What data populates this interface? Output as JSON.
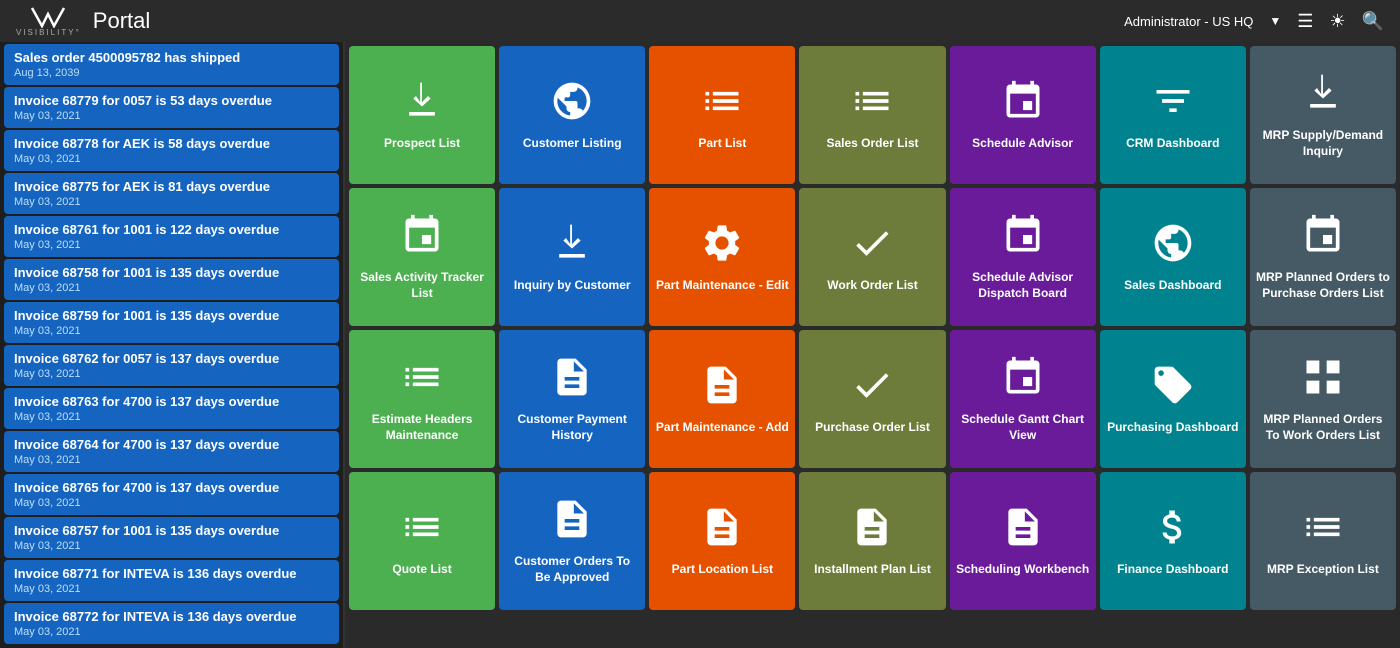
{
  "header": {
    "logo_v": "V",
    "logo_brand": "VISIBILITY°",
    "portal_label": "Portal",
    "admin_label": "Administrator - US HQ",
    "icons": [
      "hamburger",
      "globe",
      "search"
    ]
  },
  "sidebar": {
    "items": [
      {
        "title": "Sales order 4500095782 has shipped",
        "date": "Aug 13, 2039"
      },
      {
        "title": "Invoice 68779 for 0057 is 53 days overdue",
        "date": "May 03, 2021"
      },
      {
        "title": "Invoice 68778 for AEK is 58 days overdue",
        "date": "May 03, 2021"
      },
      {
        "title": "Invoice 68775 for AEK is 81 days overdue",
        "date": "May 03, 2021"
      },
      {
        "title": "Invoice 68761 for 1001 is 122 days overdue",
        "date": "May 03, 2021"
      },
      {
        "title": "Invoice 68758 for 1001 is 135 days overdue",
        "date": "May 03, 2021"
      },
      {
        "title": "Invoice 68759 for 1001 is 135 days overdue",
        "date": "May 03, 2021"
      },
      {
        "title": "Invoice 68762 for 0057 is 137 days overdue",
        "date": "May 03, 2021"
      },
      {
        "title": "Invoice 68763 for 4700 is 137 days overdue",
        "date": "May 03, 2021"
      },
      {
        "title": "Invoice 68764 for 4700 is 137 days overdue",
        "date": "May 03, 2021"
      },
      {
        "title": "Invoice 68765 for 4700 is 137 days overdue",
        "date": "May 03, 2021"
      },
      {
        "title": "Invoice 68757 for 1001 is 135 days overdue",
        "date": "May 03, 2021"
      },
      {
        "title": "Invoice 68771 for INTEVA is 136 days overdue",
        "date": "May 03, 2021"
      },
      {
        "title": "Invoice 68772 for INTEVA is 136 days overdue",
        "date": "May 03, 2021"
      }
    ]
  },
  "grid": {
    "rows": [
      [
        {
          "label": "Prospect List",
          "color": "green",
          "icon": "download-box"
        },
        {
          "label": "Customer Listing",
          "color": "blue",
          "icon": "globe"
        },
        {
          "label": "Part List",
          "color": "orange",
          "icon": "list"
        },
        {
          "label": "Sales Order List",
          "color": "olive",
          "icon": "list"
        },
        {
          "label": "Schedule Advisor",
          "color": "purple",
          "icon": "calendar"
        },
        {
          "label": "CRM Dashboard",
          "color": "teal",
          "icon": "funnel"
        },
        {
          "label": "MRP Supply/Demand Inquiry",
          "color": "dark-gray",
          "icon": "download-box"
        }
      ],
      [
        {
          "label": "Sales Activity Tracker List",
          "color": "green",
          "icon": "calendar"
        },
        {
          "label": "Inquiry by Customer",
          "color": "blue",
          "icon": "download-box"
        },
        {
          "label": "Part Maintenance - Edit",
          "color": "orange",
          "icon": "gear"
        },
        {
          "label": "Work Order List",
          "color": "olive",
          "icon": "checkmark"
        },
        {
          "label": "Schedule Advisor Dispatch Board",
          "color": "purple",
          "icon": "calendar"
        },
        {
          "label": "Sales Dashboard",
          "color": "teal",
          "icon": "globe"
        },
        {
          "label": "MRP Planned Orders to Purchase Orders List",
          "color": "dark-gray",
          "icon": "calendar-check"
        }
      ],
      [
        {
          "label": "Estimate Headers Maintenance",
          "color": "green",
          "icon": "list-lines"
        },
        {
          "label": "Customer Payment History",
          "color": "blue",
          "icon": "document"
        },
        {
          "label": "Part Maintenance - Add",
          "color": "orange",
          "icon": "document"
        },
        {
          "label": "Purchase Order List",
          "color": "olive",
          "icon": "checkmark"
        },
        {
          "label": "Schedule Gantt Chart View",
          "color": "purple",
          "icon": "calendar"
        },
        {
          "label": "Purchasing Dashboard",
          "color": "teal",
          "icon": "tag"
        },
        {
          "label": "MRP Planned Orders To Work Orders List",
          "color": "dark-gray",
          "icon": "grid"
        }
      ],
      [
        {
          "label": "Quote List",
          "color": "green",
          "icon": "list-lines"
        },
        {
          "label": "Customer Orders To Be Approved",
          "color": "blue",
          "icon": "document"
        },
        {
          "label": "Part Location List",
          "color": "orange",
          "icon": "document"
        },
        {
          "label": "Installment Plan List",
          "color": "olive",
          "icon": "document"
        },
        {
          "label": "Scheduling Workbench",
          "color": "purple",
          "icon": "document"
        },
        {
          "label": "Finance Dashboard",
          "color": "teal",
          "icon": "money"
        },
        {
          "label": "MRP Exception List",
          "color": "dark-gray",
          "icon": "list-lines"
        }
      ]
    ]
  }
}
